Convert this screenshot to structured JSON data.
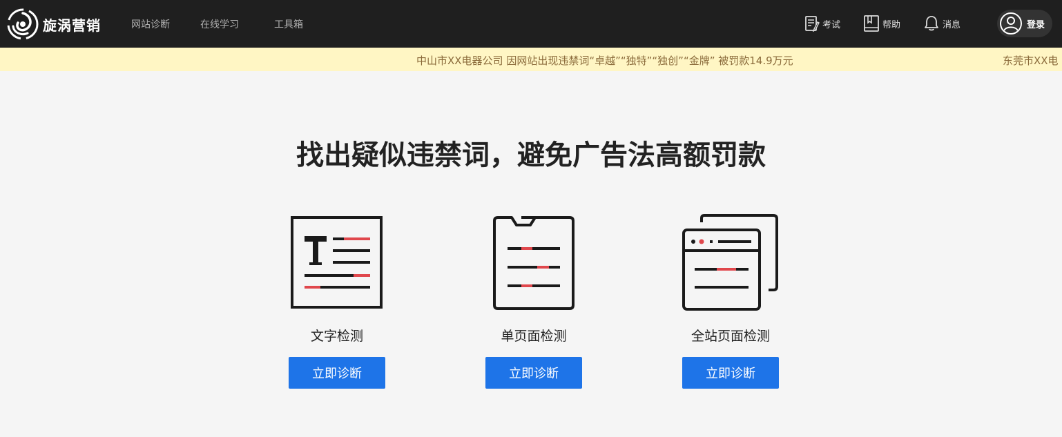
{
  "brand": {
    "name": "旋涡营销",
    "logo_icon": "swirl-logo-icon"
  },
  "nav": [
    {
      "label": "网站诊断"
    },
    {
      "label": "在线学习"
    },
    {
      "label": "工具箱"
    }
  ],
  "tools": [
    {
      "label": "考试",
      "icon": "exam-icon"
    },
    {
      "label": "帮助",
      "icon": "help-book-icon"
    },
    {
      "label": "消息",
      "icon": "bell-icon"
    }
  ],
  "login": {
    "label": "登录",
    "icon": "user-avatar-icon"
  },
  "ticker": [
    "中山市XX电器公司 因网站出现违禁词“卓越”“独特”“独创”“金牌” 被罚款14.9万元",
    "东莞市XX电"
  ],
  "hero": {
    "title": "找出疑似违禁词，避免广告法高额罚款"
  },
  "cards": [
    {
      "label": "文字检测",
      "button": "立即诊断",
      "icon": "text-detect-icon"
    },
    {
      "label": "单页面检测",
      "button": "立即诊断",
      "icon": "clipboard-detect-icon"
    },
    {
      "label": "全站页面检测",
      "button": "立即诊断",
      "icon": "browser-windows-icon"
    }
  ],
  "colors": {
    "nav_bg": "#1f1f1f",
    "ticker_bg": "#fff6c4",
    "accent": "#1e74e8",
    "highlight_red": "#e0474c"
  }
}
